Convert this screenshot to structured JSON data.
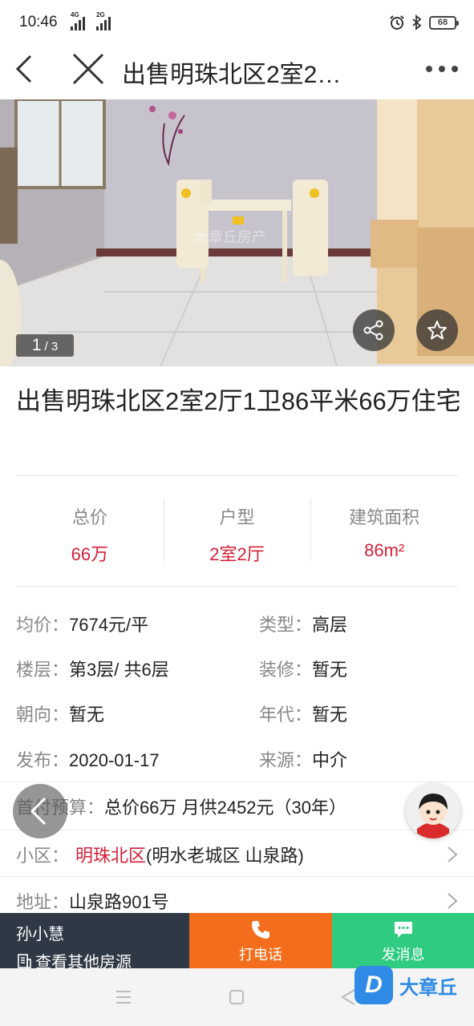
{
  "status_bar": {
    "time": "10:46",
    "network_1": "4G",
    "network_2": "2G",
    "battery": "68"
  },
  "navbar": {
    "title": "出售明珠北区2室2…"
  },
  "gallery": {
    "current": "1",
    "total": "/ 3",
    "photo_watermark": "大章丘房产"
  },
  "listing": {
    "title": "出售明珠北区2室2厅1卫86平米66万住宅"
  },
  "stats": [
    {
      "label": "总价",
      "value": "66万"
    },
    {
      "label": "户型",
      "value": "2室2厅"
    },
    {
      "label": "建筑面积",
      "value": "86m²"
    }
  ],
  "details": {
    "unit_price": {
      "label": "均价：",
      "value": "7674元/平"
    },
    "type": {
      "label": "类型：",
      "value": "高层"
    },
    "floor": {
      "label": "楼层：",
      "value": "第3层/ 共6层"
    },
    "decoration": {
      "label": "装修：",
      "value": "暂无"
    },
    "orientation": {
      "label": "朝向：",
      "value": "暂无"
    },
    "era": {
      "label": "年代：",
      "value": "暂无"
    },
    "published": {
      "label": "发布：",
      "value": "2020-01-17"
    },
    "source": {
      "label": "来源：",
      "value": "中介"
    }
  },
  "payment": {
    "label": "首付预算：",
    "value": "总价66万 月供2452元（30年）"
  },
  "community": {
    "label": "小区：",
    "name": "明珠北区",
    "area": "(明水老城区 山泉路)"
  },
  "address": {
    "label": "地址：",
    "value": "山泉路901号"
  },
  "actionbar": {
    "agent_name": "孙小慧",
    "agent_more": "查看其他房源",
    "call_label": "打电话",
    "message_label": "发消息"
  },
  "app_watermark": {
    "logo_letter": "D",
    "text": "大章丘"
  },
  "colors": {
    "accent_red": "#d6203a",
    "call_orange": "#f46d1c",
    "message_green": "#2fcb80",
    "agent_bg": "#2f3845"
  }
}
